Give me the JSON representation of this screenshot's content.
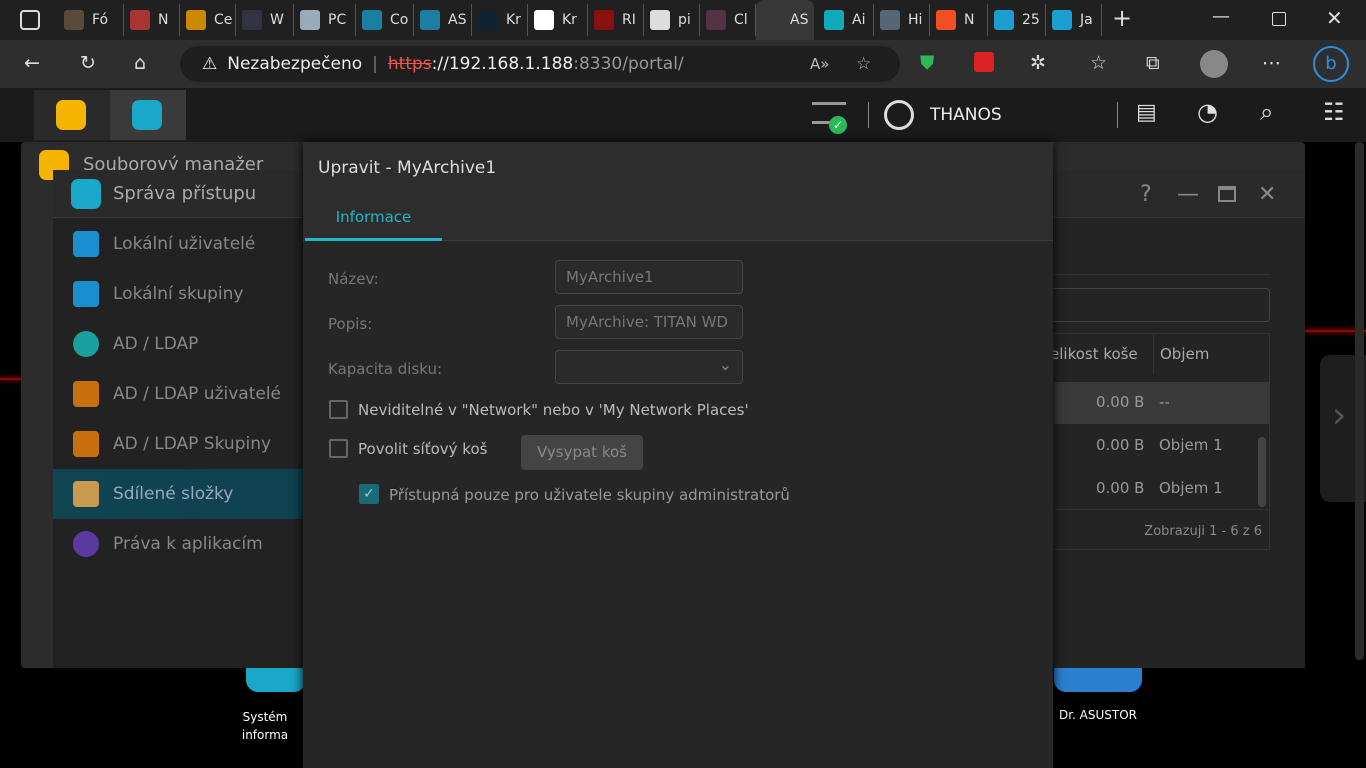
{
  "browser": {
    "tabs": [
      {
        "label": "Fó",
        "color": "#5a4a3a"
      },
      {
        "label": "N",
        "color": "#a33"
      },
      {
        "label": "Ce",
        "color": "#c80"
      },
      {
        "label": "W",
        "color": "#334"
      },
      {
        "label": "PC",
        "color": "#9ab"
      },
      {
        "label": "Co",
        "color": "#1a7fa0"
      },
      {
        "label": "AS",
        "color": "#1a7fa0"
      },
      {
        "label": "Kr",
        "color": "#123"
      },
      {
        "label": "Kr",
        "color": "#fff"
      },
      {
        "label": "RI",
        "color": "#8b1010"
      },
      {
        "label": "pi",
        "color": "#ddd"
      },
      {
        "label": "Cl",
        "color": "#534"
      },
      {
        "label": "AS",
        "color": "#383838"
      },
      {
        "label": "Ai",
        "color": "#1ab"
      },
      {
        "label": "Hi",
        "color": "#567"
      },
      {
        "label": "N",
        "color": "#f25022"
      },
      {
        "label": "25",
        "color": "#1a9fd0"
      },
      {
        "label": "Ja",
        "color": "#1a9fd0"
      }
    ],
    "active_tab_index": 12,
    "not_secure": "Nezabezpečeno",
    "url_scheme": "https",
    "url_host": "://192.168.1.188",
    "url_rest": ":8330/portal/"
  },
  "adm": {
    "username": "THANOS"
  },
  "file_manager": {
    "title": "Souborový manažer"
  },
  "access": {
    "title": "Správa přístupu",
    "sidebar": [
      {
        "label": "Lokální uživatelé",
        "color": "#1a8fd0"
      },
      {
        "label": "Lokální skupiny",
        "color": "#1a8fd0"
      },
      {
        "label": "AD / LDAP",
        "color": "#1aa0a0"
      },
      {
        "label": "AD / LDAP uživatelé",
        "color": "#c87010"
      },
      {
        "label": "AD / LDAP Skupiny",
        "color": "#c87010"
      },
      {
        "label": "Sdílené složky",
        "color": "#c89a50"
      },
      {
        "label": "Práva k aplikacím",
        "color": "#5a3aa0"
      }
    ],
    "selected_index": 5,
    "table": {
      "headers": [
        "elikost koše",
        "Objem"
      ],
      "rows": [
        [
          "0.00 B",
          "--"
        ],
        [
          "0.00 B",
          "Objem 1"
        ],
        [
          "0.00 B",
          "Objem 1"
        ]
      ],
      "footer": "Zobrazuji 1 - 6 z 6"
    }
  },
  "dialog": {
    "title": "Upravit - MyArchive1",
    "tab": "Informace",
    "name_label": "Název:",
    "name_value": "MyArchive1",
    "desc_label": "Popis:",
    "desc_value": "MyArchive: TITAN WD",
    "quota_label": "Kapacita disku:",
    "hidden_label": "Neviditelné v \"Network\" nebo v 'My Network Places'",
    "hidden_checked": false,
    "recycle_label": "Povolit síťový koš",
    "recycle_checked": false,
    "empty_button": "Vysypat koš",
    "admin_only_label": "Přístupná pouze pro uživatele skupiny administratorů",
    "admin_only_checked": true
  },
  "desktop": {
    "icons": [
      "Systém\ninforma",
      "Dr. ASUSTOR"
    ]
  }
}
